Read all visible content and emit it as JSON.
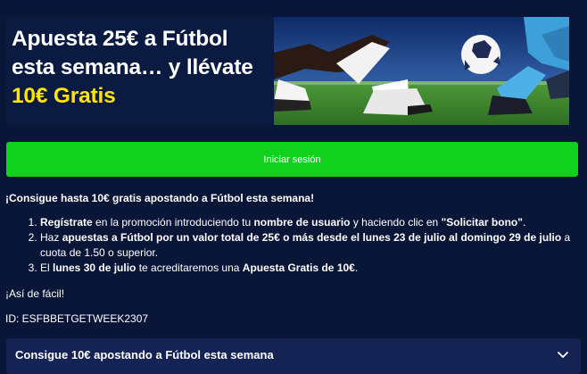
{
  "banner": {
    "line1": "Apuesta 25€ a Fútbol",
    "line2": "esta semana… y llévate",
    "highlight": "10€ Gratis",
    "highlight_color": "#ffe600",
    "image": "football-players-kicking-ball-photo"
  },
  "login_button": {
    "label": "Iniciar sesión",
    "color": "#10d21c"
  },
  "promo": {
    "headline": "¡Consigue hasta 10€ gratis apostando a Fútbol esta semana!",
    "steps": [
      {
        "a_bold": "Regístrate",
        "b": " en la promoción introduciendo tu ",
        "c_bold": "nombre de usuario",
        "d": " y haciendo clic en ",
        "e_bold": "\"Solicitar bono\"",
        "f": "."
      },
      {
        "a": "Haz ",
        "b_bold": "apuestas a Fútbol por un valor total de 25€ o más desde el lunes 23 de julio al domingo 29 de julio",
        "c": " a cuota de 1.50 o superior."
      },
      {
        "a": "El ",
        "b_bold": "lunes 30 de julio",
        "c": " te acreditaremos una ",
        "d_bold": "Apuesta Gratis de 10€",
        "e": "."
      }
    ],
    "closing": "¡Así de fácil!",
    "id_text": "ID: ESFBBETGETWEEK2307"
  },
  "accordion": {
    "title": "Consigue 10€ apostando a Fútbol esta semana",
    "icon": "chevron-down-icon"
  },
  "colors": {
    "background": "#0a1638",
    "accordion_bg": "#142354"
  }
}
